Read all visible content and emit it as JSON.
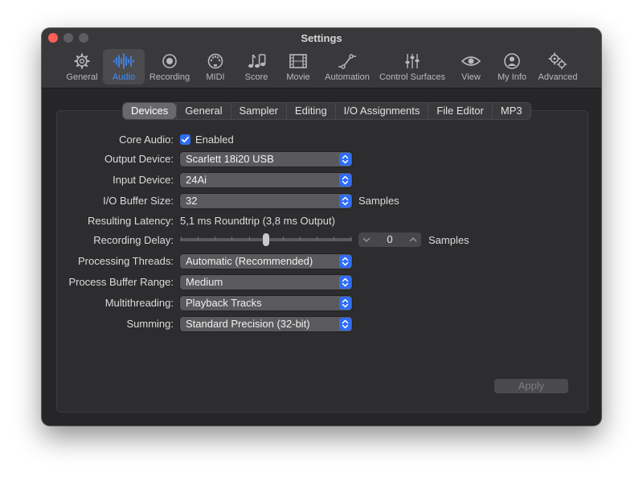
{
  "window": {
    "title": "Settings"
  },
  "toolbar": [
    {
      "id": "general",
      "label": "General",
      "icon": "gear-icon"
    },
    {
      "id": "audio",
      "label": "Audio",
      "icon": "waveform-icon",
      "active": true
    },
    {
      "id": "recording",
      "label": "Recording",
      "icon": "record-icon"
    },
    {
      "id": "midi",
      "label": "MIDI",
      "icon": "midi-port-icon"
    },
    {
      "id": "score",
      "label": "Score",
      "icon": "music-notes-icon"
    },
    {
      "id": "movie",
      "label": "Movie",
      "icon": "film-icon"
    },
    {
      "id": "automation",
      "label": "Automation",
      "icon": "automation-curve-icon"
    },
    {
      "id": "control-surfaces",
      "label": "Control Surfaces",
      "icon": "faders-icon"
    },
    {
      "id": "view",
      "label": "View",
      "icon": "eye-icon"
    },
    {
      "id": "my-info",
      "label": "My Info",
      "icon": "person-icon"
    },
    {
      "id": "advanced",
      "label": "Advanced",
      "icon": "gears-icon"
    }
  ],
  "subtabs": [
    "Devices",
    "General",
    "Sampler",
    "Editing",
    "I/O Assignments",
    "File Editor",
    "MP3"
  ],
  "active_subtab": "Devices",
  "form": {
    "core_audio": {
      "label": "Core Audio:",
      "checkbox_label": "Enabled",
      "checked": true
    },
    "output_device": {
      "label": "Output Device:",
      "value": "Scarlett 18i20 USB"
    },
    "input_device": {
      "label": "Input Device:",
      "value": "24Ai"
    },
    "io_buffer_size": {
      "label": "I/O Buffer Size:",
      "value": "32",
      "unit": "Samples"
    },
    "resulting_latency": {
      "label": "Resulting Latency:",
      "value": "5,1 ms Roundtrip (3,8 ms Output)"
    },
    "recording_delay": {
      "label": "Recording Delay:",
      "value": "0",
      "unit": "Samples",
      "slider_fraction": 0.5
    },
    "processing_threads": {
      "label": "Processing Threads:",
      "value": "Automatic (Recommended)"
    },
    "process_buffer_range": {
      "label": "Process Buffer Range:",
      "value": "Medium"
    },
    "multithreading": {
      "label": "Multithreading:",
      "value": "Playback Tracks"
    },
    "summing": {
      "label": "Summing:",
      "value": "Standard Precision (32-bit)"
    }
  },
  "apply_label": "Apply",
  "colors": {
    "accent": "#2f6df6",
    "active_tab_text": "#3f8dff",
    "close_button": "#fe5f57"
  }
}
